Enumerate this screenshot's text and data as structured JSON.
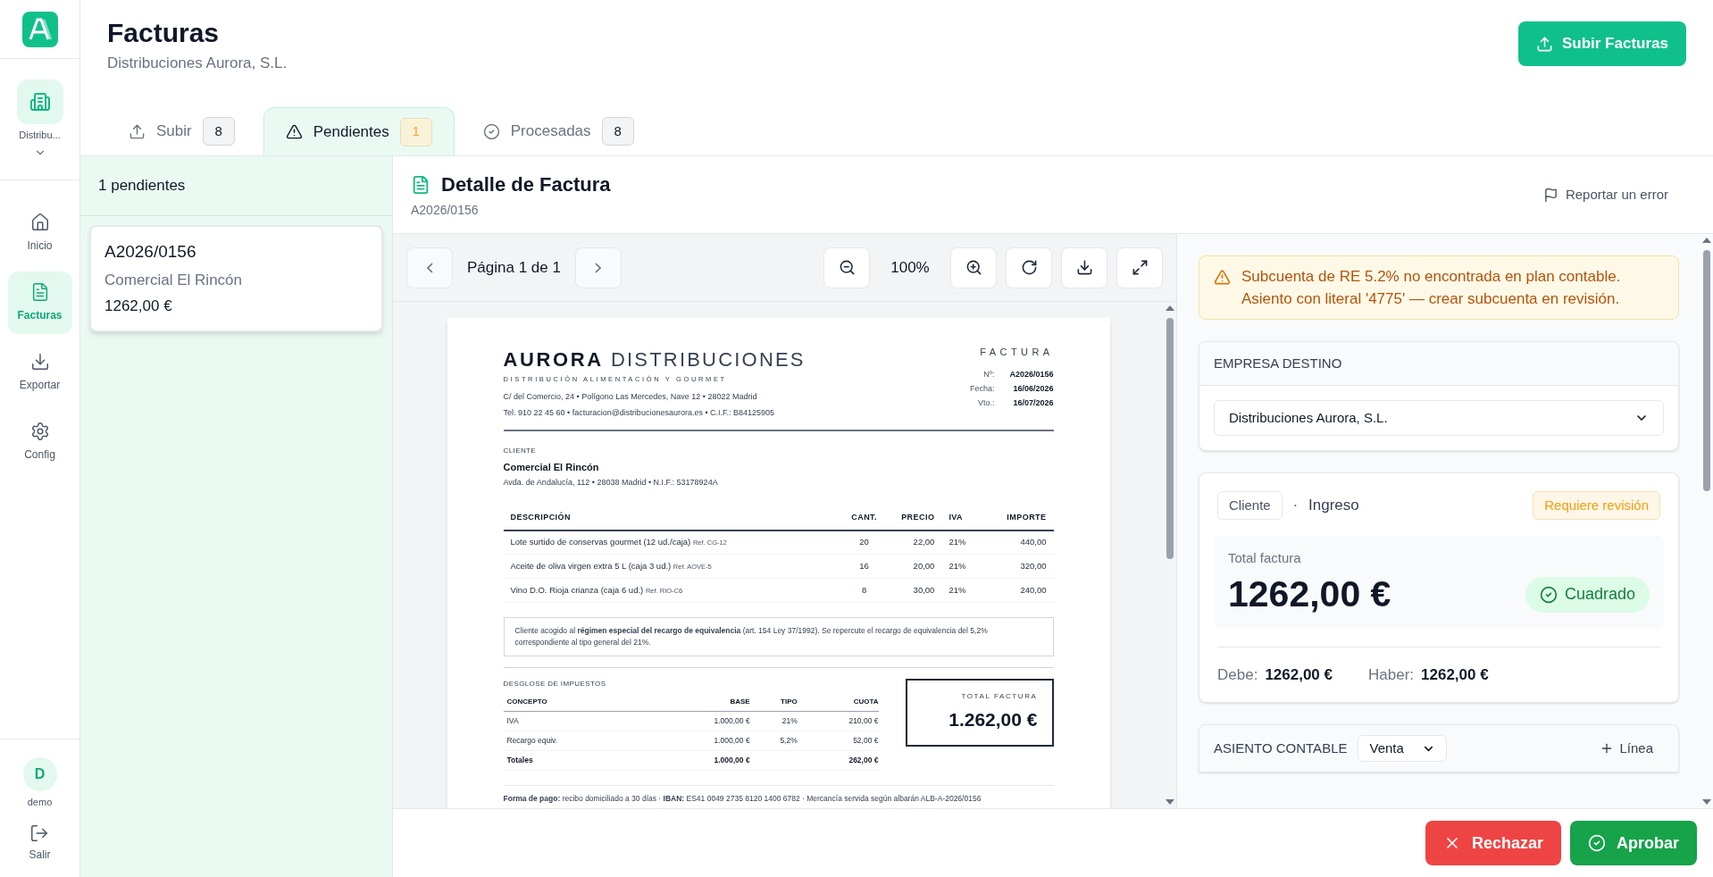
{
  "sidebar": {
    "company": "Distribu...",
    "items": [
      {
        "label": "Inicio",
        "selected": false
      },
      {
        "label": "Facturas",
        "selected": true
      },
      {
        "label": "Exportar",
        "selected": false
      },
      {
        "label": "Config",
        "selected": false
      }
    ],
    "user": {
      "initial": "D",
      "name": "demo"
    },
    "logout": "Salir"
  },
  "header": {
    "title": "Facturas",
    "subtitle": "Distribuciones Aurora, S.L.",
    "upload_button": "Subir Facturas"
  },
  "tabs": [
    {
      "label": "Subir",
      "count": "8",
      "selected": false
    },
    {
      "label": "Pendientes",
      "count": "1",
      "selected": true
    },
    {
      "label": "Procesadas",
      "count": "8",
      "selected": false
    }
  ],
  "list": {
    "heading": "1 pendientes",
    "items": [
      {
        "number": "A2026/0156",
        "client": "Comercial El Rincón",
        "amount": "1262,00 €",
        "selected": true
      }
    ]
  },
  "detail": {
    "title": "Detalle de Factura",
    "number": "A2026/0156",
    "report_link": "Reportar un error"
  },
  "viewer": {
    "page": "Página 1 de 1",
    "zoom": "100%"
  },
  "document": {
    "brand_bold": "AURORA",
    "brand_light": "DISTRIBUCIONES",
    "tagline": "DISTRIBUCIÓN ALIMENTACIÓN Y GOURMET",
    "address": "C/ del Comercio, 24 • Polígono Las Mercedes, Nave 12 • 28022 Madrid",
    "contact": "Tel. 910 22 45 60 • facturacion@distribucionesaurora.es • C.I.F.: B84125905",
    "doc_type": "FACTURA",
    "meta": [
      {
        "label": "Nº:",
        "value": "A2026/0156"
      },
      {
        "label": "Fecha:",
        "value": "16/06/2026"
      },
      {
        "label": "Vto.:",
        "value": "16/07/2026"
      }
    ],
    "client_label": "CLIENTE",
    "client_name": "Comercial El Rincón",
    "client_address": "Avda. de Andalucía, 112 • 28038 Madrid • N.I.F.: 53178924A",
    "columns": [
      "DESCRIPCIÓN",
      "CANT.",
      "PRECIO",
      "IVA",
      "IMPORTE"
    ],
    "rows": [
      {
        "description": "Lote surtido de conservas gourmet (12 ud./caja)",
        "ref": "Ref. CG-12",
        "qty": "20",
        "price": "22,00",
        "vat": "21%",
        "amount": "440,00"
      },
      {
        "description": "Aceite de oliva virgen extra 5 L (caja 3 ud.)",
        "ref": "Ref. AOVE-5",
        "qty": "16",
        "price": "20,00",
        "vat": "21%",
        "amount": "320,00"
      },
      {
        "description": "Vino D.O. Rioja crianza (caja 6 ud.)",
        "ref": "Ref. RIO-C6",
        "qty": "8",
        "price": "30,00",
        "vat": "21%",
        "amount": "240,00"
      }
    ],
    "note": "Cliente acogido al **régimen especial del recargo de equivalencia** (art. 154 Ley 37/1992). Se repercute el recargo de equivalencia del 5,2% correspondiente al tipo general del 21%.",
    "tax_title": "DESGLOSE DE IMPUESTOS",
    "tax_columns": [
      "CONCEPTO",
      "BASE",
      "TIPO",
      "CUOTA"
    ],
    "tax_rows": [
      {
        "kind": "line",
        "concept": "IVA",
        "base": "1.000,00 €",
        "rate": "21%",
        "fee": "210,00 €"
      },
      {
        "kind": "line",
        "concept": "Recargo equiv.",
        "base": "1.000,00 €",
        "rate": "5,2%",
        "fee": "52,00 €"
      },
      {
        "kind": "total",
        "concept": "Totales",
        "base": "1.000,00 €",
        "fee": "262,00 €"
      }
    ],
    "total_label": "TOTAL FACTURA",
    "total_value": "1.262,00 €",
    "payment": "**Forma de pago:** recibo domiciliado a 30 días · **IBAN:** ES41 0049 2735 8120 1400 6782 · Mercancía servida según albarán ALB-A-2026/0156"
  },
  "panel": {
    "alert": "Subcuenta de RE 5.2% no encontrada en plan contable. Asiento con literal '4775' — crear subcuenta en revisión.",
    "destination": {
      "label": "EMPRESA DESTINO",
      "value": "Distribuciones Aurora, S.L."
    },
    "entry": {
      "role": "Cliente",
      "separator": "·",
      "type": "Ingreso",
      "status": "Requiere revisión",
      "total_label": "Total factura",
      "total": "1262,00 €",
      "balance": "Cuadrado",
      "debit_label": "Debe:",
      "debit": "1262,00 €",
      "credit_label": "Haber:",
      "credit": "1262,00 €"
    },
    "journal": {
      "label": "ASIENTO CONTABLE",
      "type": "Venta",
      "add": "Línea"
    }
  },
  "footer": {
    "reject": "Rechazar",
    "approve": "Aprobar"
  }
}
